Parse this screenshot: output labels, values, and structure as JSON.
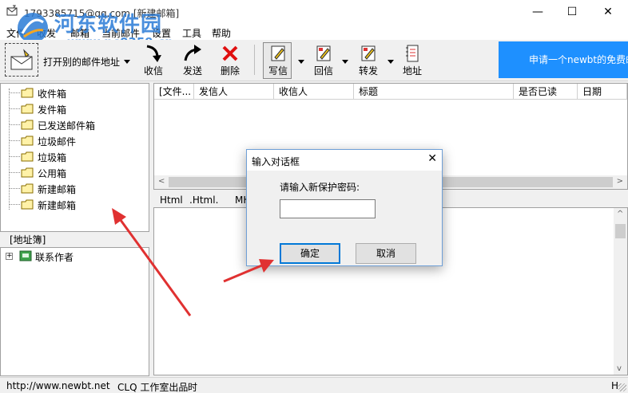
{
  "window": {
    "title": "1793385715@qq.com [新建邮箱]",
    "minimize": "—",
    "maximize": "☐",
    "close": "✕"
  },
  "menu": {
    "items": [
      "文件",
      "收发",
      "邮箱",
      "当前邮件",
      "设置",
      "工具",
      "帮助"
    ]
  },
  "watermark": {
    "title": "河东软件园",
    "url": "www.pc0359.cn"
  },
  "toolbar": {
    "open_addr": "打开别的邮件地址",
    "receive": "收信",
    "send": "发送",
    "delete": "删除",
    "write": "写信",
    "reply": "回信",
    "forward": "转发",
    "address": "地址",
    "banner": "申请一个newbt的免费邮"
  },
  "folders": {
    "items": [
      "收件箱",
      "发件箱",
      "已发送邮件箱",
      "垃圾邮件",
      "垃圾箱",
      "公用箱",
      "新建邮箱",
      "新建邮箱"
    ]
  },
  "address_book": {
    "header": "[地址簿]",
    "expand": "+",
    "contact_group": "联系作者"
  },
  "mail_list": {
    "columns": [
      "[文件...",
      "发信人",
      "收信人",
      "标题",
      "是否已读",
      "日期"
    ]
  },
  "preview": {
    "tabs": [
      "Html",
      ".Html.",
      "MH"
    ]
  },
  "statusbar": {
    "url": "http://www.newbt.net",
    "studio": "CLQ 工作室出品",
    "time": "时",
    "right": "H"
  },
  "dialog": {
    "title": "输入对话框",
    "close": "✕",
    "prompt": "请输入新保护密码:",
    "input_value": "",
    "ok": "确定",
    "cancel": "取消"
  },
  "colors": {
    "banner": "#1e90ff",
    "annotation_arrow": "#e03131",
    "watermark": "#2a7bd6"
  }
}
